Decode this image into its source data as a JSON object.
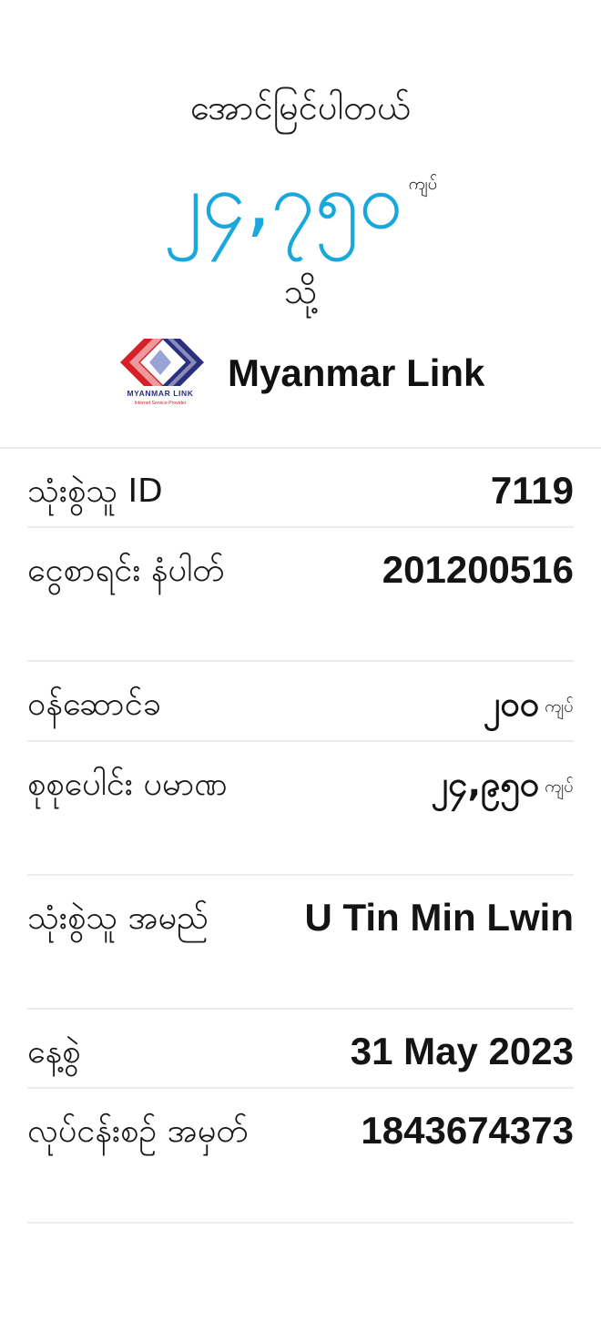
{
  "header": {
    "status": "အောင်မြင်ပါတယ်",
    "amount": "၂၄,၇၅၀",
    "amount_unit": "ကျပ်",
    "to_label": "သို့",
    "merchant": {
      "name": "Myanmar Link",
      "logo_text": "MYANMAR LINK",
      "logo_subtext": "Internet Service Provider",
      "logo_icon": "myanmar-link-logo"
    }
  },
  "details": [
    {
      "label": "သုံးစွဲသူ ID",
      "value": "7119",
      "unit": ""
    },
    {
      "label": "ငွေစာရင်း နံပါတ်",
      "value": "201200516",
      "unit": ""
    },
    {
      "label": "ဝန်ဆောင်ခ",
      "value": "၂၀၀",
      "unit": "ကျပ်"
    },
    {
      "label": "စုစုပေါင်း ပမာဏ",
      "value": "၂၄,၉၅၀",
      "unit": "ကျပ်"
    },
    {
      "label": "သုံးစွဲသူ အမည်",
      "value": "U Tin Min Lwin",
      "unit": ""
    },
    {
      "label": "နေ့စွဲ",
      "value": "31 May 2023",
      "unit": ""
    },
    {
      "label": "လုပ်ငန်းစဉ် အမှတ်",
      "value": "1843674373",
      "unit": ""
    }
  ],
  "colors": {
    "accent": "#19a8dc",
    "divider": "#ececec",
    "logo_red": "#d62027",
    "logo_navy": "#2a2f7e"
  }
}
